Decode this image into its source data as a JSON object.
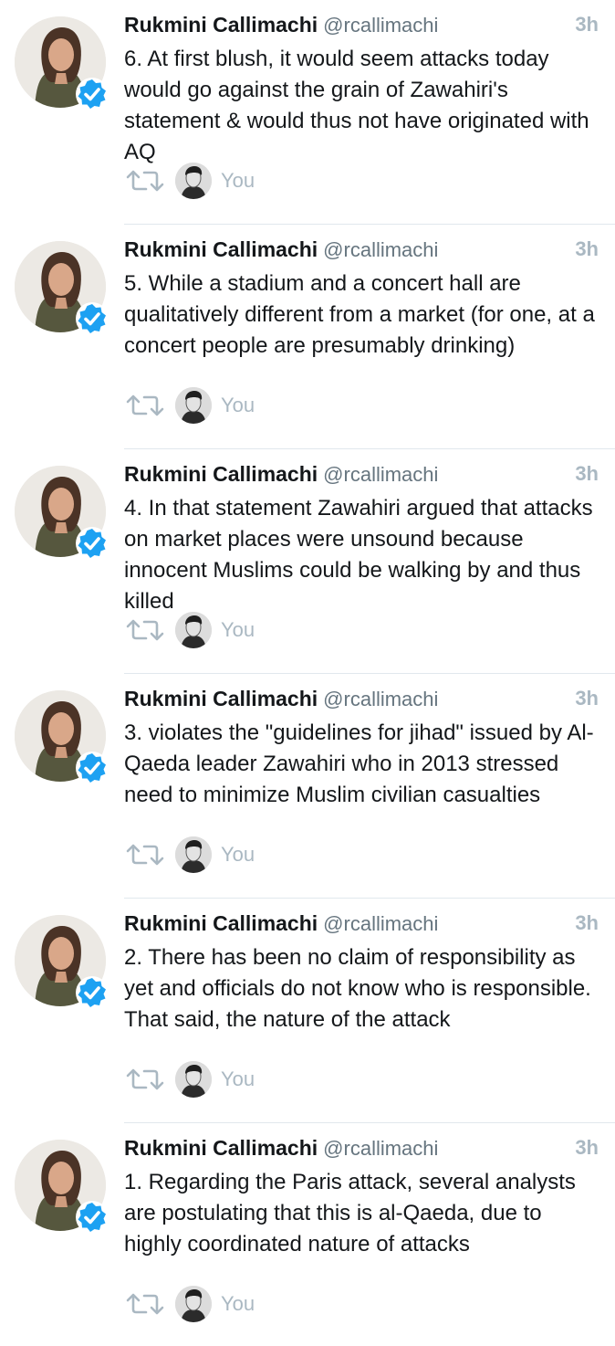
{
  "tweets": [
    {
      "name": "Rukmini Callimachi",
      "handle": "@rcallimachi",
      "time": "3h",
      "text": "6. At first blush, it would seem attacks today would go against the grain of Zawahiri's statement & would thus not have originated with AQ",
      "liked_by": "You"
    },
    {
      "name": "Rukmini Callimachi",
      "handle": "@rcallimachi",
      "time": "3h",
      "text": "5. While a stadium and a concert hall are qualitatively different from a market (for one, at a concert people are presumably drinking)",
      "liked_by": "You"
    },
    {
      "name": "Rukmini Callimachi",
      "handle": "@rcallimachi",
      "time": "3h",
      "text": "4. In that statement Zawahiri argued that attacks on market places were unsound because innocent Muslims could be walking by and thus killed",
      "liked_by": "You"
    },
    {
      "name": "Rukmini Callimachi",
      "handle": "@rcallimachi",
      "time": "3h",
      "text": "3.  violates the \"guidelines for jihad\" issued by Al-Qaeda leader Zawahiri who in 2013 stressed need to minimize Muslim civilian casualties",
      "liked_by": "You"
    },
    {
      "name": "Rukmini Callimachi",
      "handle": "@rcallimachi",
      "time": "3h",
      "text": "2. There has been no claim of responsibility as yet and officials do not know who is responsible. That said, the nature of the attack",
      "liked_by": "You"
    },
    {
      "name": "Rukmini Callimachi",
      "handle": "@rcallimachi",
      "time": "3h",
      "text": "1. Regarding the Paris attack, several analysts are postulating that this is al-Qaeda, due to highly coordinated nature of attacks",
      "liked_by": "You"
    }
  ],
  "icons": {
    "verified": "verified-badge-icon",
    "retweet": "retweet-icon"
  },
  "colors": {
    "verified": "#1da1f2",
    "muted": "#aab8c2",
    "handle": "#66757f",
    "text": "#14171a",
    "divider": "#e1e8ed"
  }
}
